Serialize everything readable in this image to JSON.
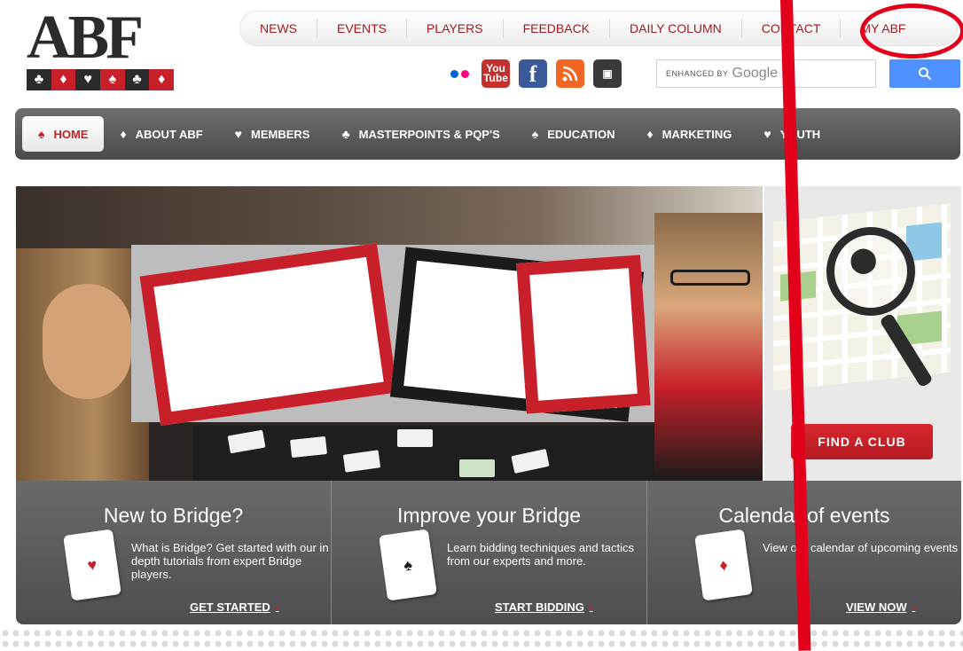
{
  "logo": {
    "text": "ABF",
    "suits": [
      "♣",
      "♦",
      "♥",
      "♠",
      "♣",
      "♦"
    ]
  },
  "topnav": {
    "items": [
      "NEWS",
      "EVENTS",
      "PLAYERS",
      "FEEDBACK",
      "DAILY COLUMN",
      "CONTACT",
      "MY ABF"
    ]
  },
  "social": {
    "youtube_label": "You\nTube",
    "facebook_label": "f",
    "rss_label": "RSS",
    "app_label": "▣",
    "icons": [
      "flickr-icon",
      "youtube-icon",
      "facebook-icon",
      "rss-icon",
      "app-icon"
    ]
  },
  "search": {
    "enhanced_by": "ENHANCED BY",
    "google": "Google",
    "button_icon": "search-icon"
  },
  "mainnav": {
    "items": [
      {
        "label": "HOME",
        "suit": "♠",
        "active": true
      },
      {
        "label": "ABOUT ABF",
        "suit": "♦",
        "active": false
      },
      {
        "label": "MEMBERS",
        "suit": "♥",
        "active": false
      },
      {
        "label": "MASTERPOINTS & PQP'S",
        "suit": "♣",
        "active": false
      },
      {
        "label": "EDUCATION",
        "suit": "♠",
        "active": false
      },
      {
        "label": "MARKETING",
        "suit": "♦",
        "active": false
      },
      {
        "label": "YOUTH",
        "suit": "♥",
        "active": false
      }
    ]
  },
  "club": {
    "button_label": "FIND A CLUB"
  },
  "panels": [
    {
      "title": "New to Bridge?",
      "suit": "♥",
      "suit_color": "#c8202a",
      "text": "What is Bridge? Get started with our in depth tutorials from expert Bridge players.",
      "cta": "GET STARTED"
    },
    {
      "title": "Improve your Bridge",
      "suit": "♠",
      "suit_color": "#1b1b1b",
      "text": "Learn bidding techniques and tactics from our experts and more.",
      "cta": "START BIDDING"
    },
    {
      "title": "Calendar of events",
      "suit": "♦",
      "suit_color": "#c8202a",
      "text": "View our calendar of upcoming events",
      "cta": "VIEW NOW"
    }
  ],
  "colors": {
    "brand_red": "#c8202a",
    "nav_dark": "#555555",
    "link_red": "#9e1b21",
    "annotation_red": "#e3001b"
  }
}
